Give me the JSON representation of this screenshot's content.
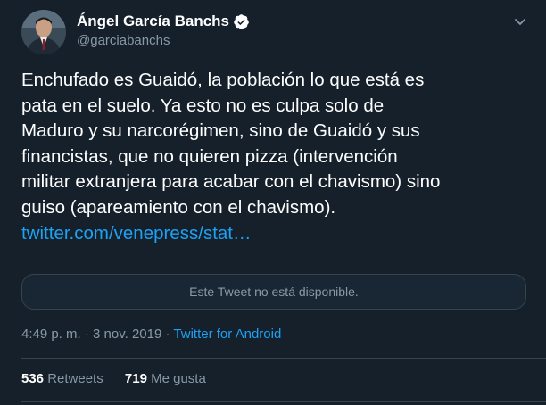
{
  "author": {
    "display_name": "Ángel García Banchs",
    "handle": "@garciabanchs",
    "verified": true
  },
  "tweet": {
    "text_lines": [
      "Enchufado es Guaidó, la población lo que está es",
      "pata en el suelo. Ya esto no es culpa solo de",
      "Maduro y su narcorégimen, sino de Guaidó y sus",
      "financistas, que no quieren pizza (intervención",
      "militar extranjera para acabar con el chavismo) sino",
      "guiso (apareamiento con el chavismo)."
    ],
    "link": "twitter.com/venepress/stat…"
  },
  "quoted_tweet": {
    "unavailable_text": "Este Tweet no está disponible."
  },
  "meta": {
    "time": "4:49 p. m.",
    "separator1": " · ",
    "date": "3 nov. 2019",
    "separator2": " · ",
    "source": "Twitter for Android"
  },
  "stats": {
    "retweets_count": "536",
    "retweets_label": " Retweets",
    "likes_count": "719",
    "likes_label": " Me gusta"
  },
  "icons": {
    "verified": "verified-badge-icon",
    "caret": "chevron-down-icon"
  },
  "colors": {
    "background": "#15202b",
    "accent": "#1da1f2",
    "secondary_text": "#8899a6",
    "border": "#38444d"
  }
}
